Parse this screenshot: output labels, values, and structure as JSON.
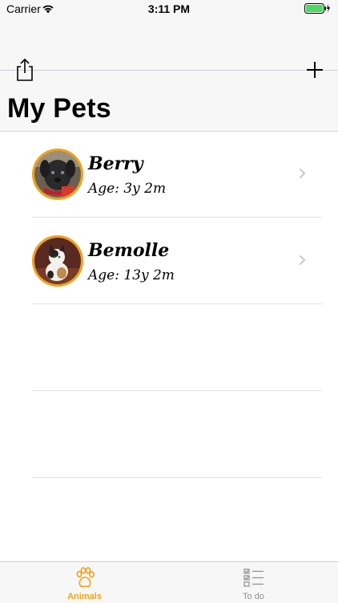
{
  "status_bar": {
    "carrier": "Carrier",
    "time": "3:11 PM",
    "battery_color": "#4cd964"
  },
  "nav": {
    "title": "My Pets",
    "share_icon": "share-icon",
    "add_icon": "plus-icon"
  },
  "pets": [
    {
      "name": "Berry",
      "age": "Age: 3y 2m",
      "avatar_desc": "black puppy photo"
    },
    {
      "name": "Bemolle",
      "age": "Age: 13y 2m",
      "avatar_desc": "calico cat photo"
    }
  ],
  "tabs": [
    {
      "label": "Animals",
      "icon": "paw-icon",
      "active": true
    },
    {
      "label": "To do",
      "icon": "checklist-icon",
      "active": false
    }
  ],
  "colors": {
    "accent": "#f0a219",
    "separator": "#e3e3e6",
    "chevron": "#c7c7cc"
  }
}
